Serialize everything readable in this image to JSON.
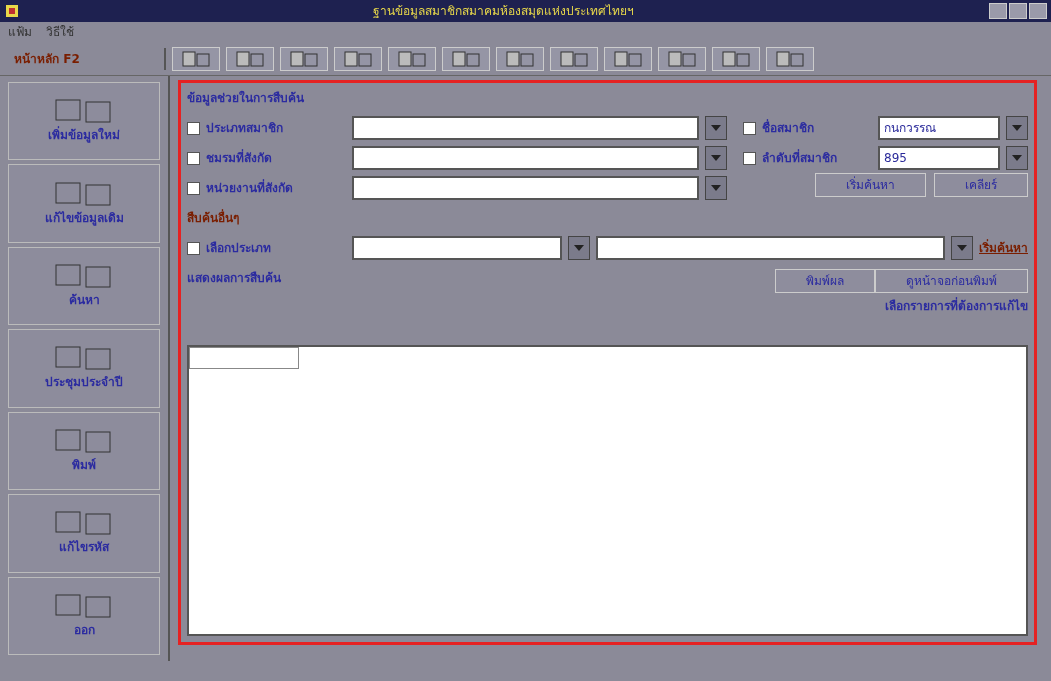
{
  "window": {
    "title": "ฐานข้อมูลสมาชิกสมาคมห้องสมุดแห่งประเทศไทยฯ"
  },
  "menu": [
    "แฟ้ม",
    "วิธีใช้"
  ],
  "home_label": "หน้าหลัก F2",
  "sidebar": [
    {
      "label": "เพิ่มข้อมูลใหม่"
    },
    {
      "label": "แก้ไขข้อมูลเดิม"
    },
    {
      "label": "ค้นหา"
    },
    {
      "label": "ประชุมประจำปี"
    },
    {
      "label": "พิมพ์"
    },
    {
      "label": "แก้ไขรหัส"
    },
    {
      "label": "ออก"
    }
  ],
  "search": {
    "title": "ข้อมูลช่วยในการสืบค้น",
    "left_fields": [
      {
        "label": "ประเภทสมาชิก",
        "checked": false
      },
      {
        "label": "ชมรมที่สังกัด",
        "checked": false
      },
      {
        "label": "หน่วยงานที่สังกัด",
        "checked": false
      }
    ],
    "right_fields": [
      {
        "label": "ชื่อสมาชิก",
        "checked": false,
        "value": "กนกวรรณ"
      },
      {
        "label": "ลำดับที่สมาชิก",
        "checked": false,
        "value": "895"
      }
    ],
    "buttons": [
      "เริ่มค้นหา",
      "เคลียร์"
    ]
  },
  "other": {
    "title": "สืบค้นอื่นๆ",
    "label": "เลือกประเภท",
    "checked": false,
    "link": "เริ่มค้นหา"
  },
  "results": {
    "title": "แสดงผลการสืบค้น",
    "buttons": [
      "พิมพ์ผล",
      "ดูหน้าจอก่อนพิมพ์"
    ],
    "hint": "เลือกรายการที่ต้องการแก้ไข"
  }
}
